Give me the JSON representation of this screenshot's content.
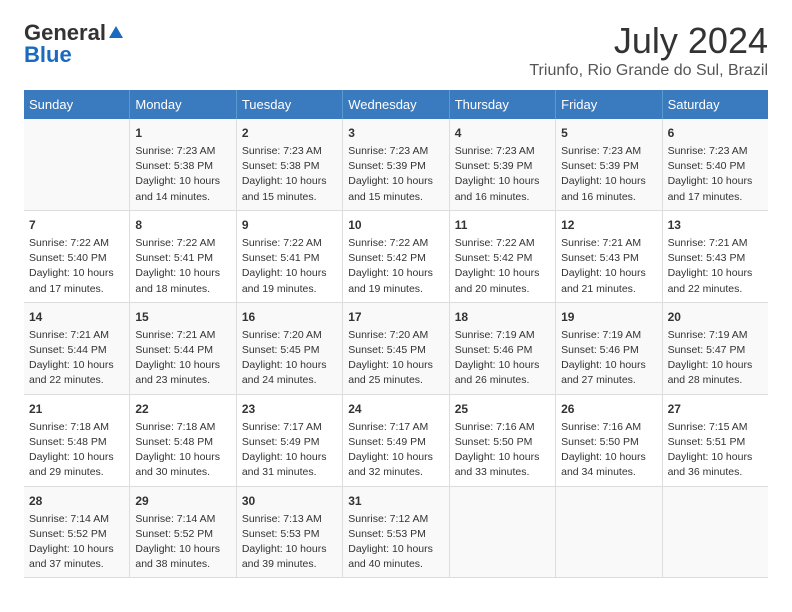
{
  "header": {
    "logo_general": "General",
    "logo_blue": "Blue",
    "month_year": "July 2024",
    "location": "Triunfo, Rio Grande do Sul, Brazil"
  },
  "days_of_week": [
    "Sunday",
    "Monday",
    "Tuesday",
    "Wednesday",
    "Thursday",
    "Friday",
    "Saturday"
  ],
  "weeks": [
    [
      {
        "day": "",
        "content": ""
      },
      {
        "day": "1",
        "content": "Sunrise: 7:23 AM\nSunset: 5:38 PM\nDaylight: 10 hours\nand 14 minutes."
      },
      {
        "day": "2",
        "content": "Sunrise: 7:23 AM\nSunset: 5:38 PM\nDaylight: 10 hours\nand 15 minutes."
      },
      {
        "day": "3",
        "content": "Sunrise: 7:23 AM\nSunset: 5:39 PM\nDaylight: 10 hours\nand 15 minutes."
      },
      {
        "day": "4",
        "content": "Sunrise: 7:23 AM\nSunset: 5:39 PM\nDaylight: 10 hours\nand 16 minutes."
      },
      {
        "day": "5",
        "content": "Sunrise: 7:23 AM\nSunset: 5:39 PM\nDaylight: 10 hours\nand 16 minutes."
      },
      {
        "day": "6",
        "content": "Sunrise: 7:23 AM\nSunset: 5:40 PM\nDaylight: 10 hours\nand 17 minutes."
      }
    ],
    [
      {
        "day": "7",
        "content": "Sunrise: 7:22 AM\nSunset: 5:40 PM\nDaylight: 10 hours\nand 17 minutes."
      },
      {
        "day": "8",
        "content": "Sunrise: 7:22 AM\nSunset: 5:41 PM\nDaylight: 10 hours\nand 18 minutes."
      },
      {
        "day": "9",
        "content": "Sunrise: 7:22 AM\nSunset: 5:41 PM\nDaylight: 10 hours\nand 19 minutes."
      },
      {
        "day": "10",
        "content": "Sunrise: 7:22 AM\nSunset: 5:42 PM\nDaylight: 10 hours\nand 19 minutes."
      },
      {
        "day": "11",
        "content": "Sunrise: 7:22 AM\nSunset: 5:42 PM\nDaylight: 10 hours\nand 20 minutes."
      },
      {
        "day": "12",
        "content": "Sunrise: 7:21 AM\nSunset: 5:43 PM\nDaylight: 10 hours\nand 21 minutes."
      },
      {
        "day": "13",
        "content": "Sunrise: 7:21 AM\nSunset: 5:43 PM\nDaylight: 10 hours\nand 22 minutes."
      }
    ],
    [
      {
        "day": "14",
        "content": "Sunrise: 7:21 AM\nSunset: 5:44 PM\nDaylight: 10 hours\nand 22 minutes."
      },
      {
        "day": "15",
        "content": "Sunrise: 7:21 AM\nSunset: 5:44 PM\nDaylight: 10 hours\nand 23 minutes."
      },
      {
        "day": "16",
        "content": "Sunrise: 7:20 AM\nSunset: 5:45 PM\nDaylight: 10 hours\nand 24 minutes."
      },
      {
        "day": "17",
        "content": "Sunrise: 7:20 AM\nSunset: 5:45 PM\nDaylight: 10 hours\nand 25 minutes."
      },
      {
        "day": "18",
        "content": "Sunrise: 7:19 AM\nSunset: 5:46 PM\nDaylight: 10 hours\nand 26 minutes."
      },
      {
        "day": "19",
        "content": "Sunrise: 7:19 AM\nSunset: 5:46 PM\nDaylight: 10 hours\nand 27 minutes."
      },
      {
        "day": "20",
        "content": "Sunrise: 7:19 AM\nSunset: 5:47 PM\nDaylight: 10 hours\nand 28 minutes."
      }
    ],
    [
      {
        "day": "21",
        "content": "Sunrise: 7:18 AM\nSunset: 5:48 PM\nDaylight: 10 hours\nand 29 minutes."
      },
      {
        "day": "22",
        "content": "Sunrise: 7:18 AM\nSunset: 5:48 PM\nDaylight: 10 hours\nand 30 minutes."
      },
      {
        "day": "23",
        "content": "Sunrise: 7:17 AM\nSunset: 5:49 PM\nDaylight: 10 hours\nand 31 minutes."
      },
      {
        "day": "24",
        "content": "Sunrise: 7:17 AM\nSunset: 5:49 PM\nDaylight: 10 hours\nand 32 minutes."
      },
      {
        "day": "25",
        "content": "Sunrise: 7:16 AM\nSunset: 5:50 PM\nDaylight: 10 hours\nand 33 minutes."
      },
      {
        "day": "26",
        "content": "Sunrise: 7:16 AM\nSunset: 5:50 PM\nDaylight: 10 hours\nand 34 minutes."
      },
      {
        "day": "27",
        "content": "Sunrise: 7:15 AM\nSunset: 5:51 PM\nDaylight: 10 hours\nand 36 minutes."
      }
    ],
    [
      {
        "day": "28",
        "content": "Sunrise: 7:14 AM\nSunset: 5:52 PM\nDaylight: 10 hours\nand 37 minutes."
      },
      {
        "day": "29",
        "content": "Sunrise: 7:14 AM\nSunset: 5:52 PM\nDaylight: 10 hours\nand 38 minutes."
      },
      {
        "day": "30",
        "content": "Sunrise: 7:13 AM\nSunset: 5:53 PM\nDaylight: 10 hours\nand 39 minutes."
      },
      {
        "day": "31",
        "content": "Sunrise: 7:12 AM\nSunset: 5:53 PM\nDaylight: 10 hours\nand 40 minutes."
      },
      {
        "day": "",
        "content": ""
      },
      {
        "day": "",
        "content": ""
      },
      {
        "day": "",
        "content": ""
      }
    ]
  ]
}
